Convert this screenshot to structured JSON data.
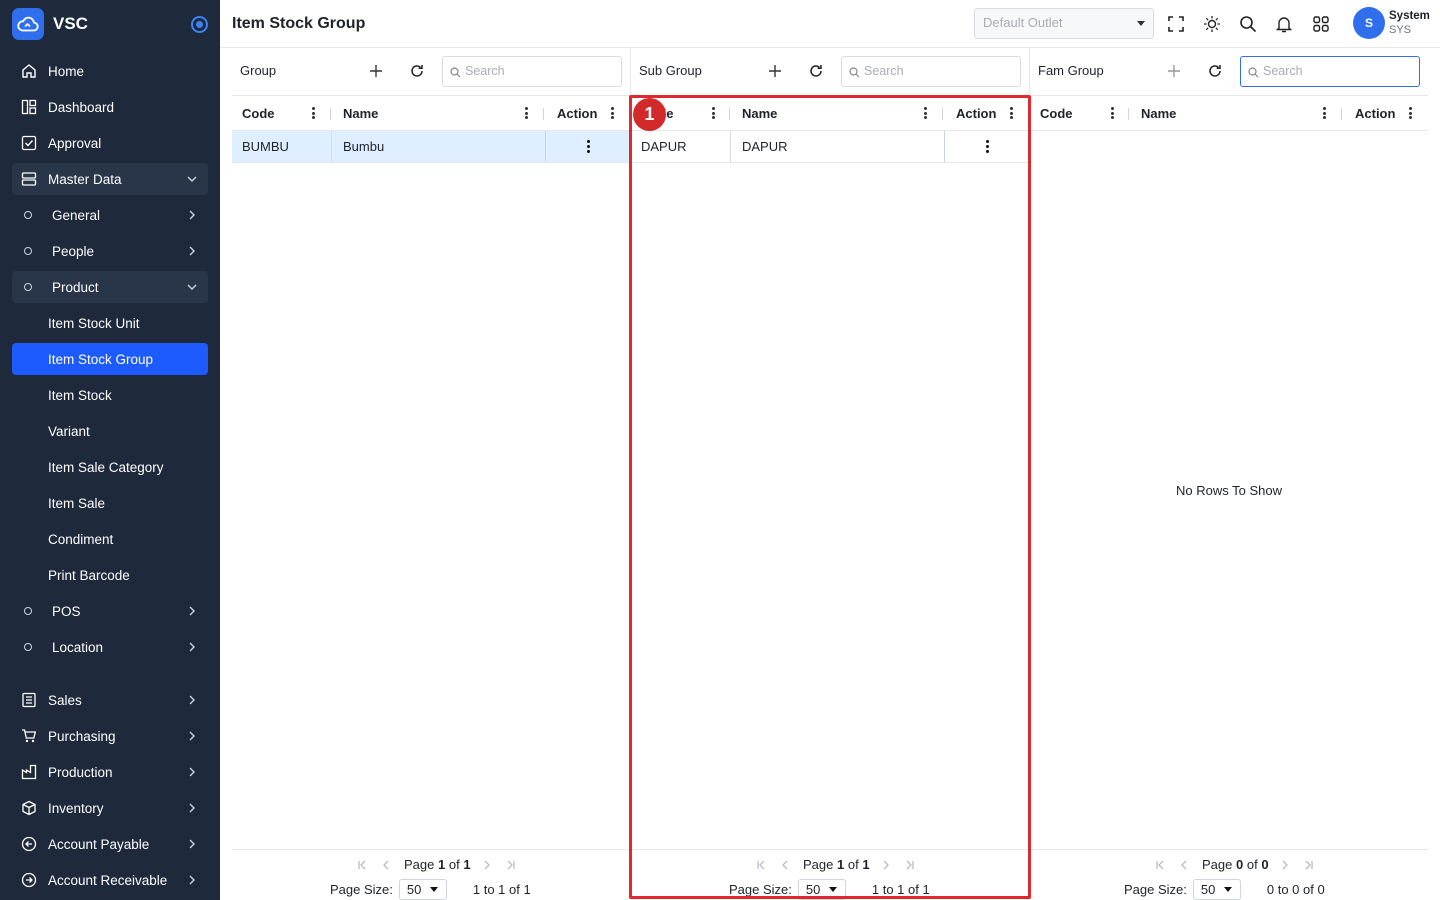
{
  "app": {
    "brand": "VSC"
  },
  "sidebar": {
    "items": [
      {
        "label": "Home",
        "icon": "home-icon"
      },
      {
        "label": "Dashboard",
        "icon": "dashboard-icon"
      },
      {
        "label": "Approval",
        "icon": "approval-icon"
      },
      {
        "label": "Master Data",
        "icon": "master-data-icon"
      }
    ],
    "master": [
      {
        "label": "General"
      },
      {
        "label": "People"
      },
      {
        "label": "Product"
      }
    ],
    "product": [
      {
        "label": "Item Stock Unit"
      },
      {
        "label": "Item Stock Group"
      },
      {
        "label": "Item Stock"
      },
      {
        "label": "Variant"
      },
      {
        "label": "Item Sale Category"
      },
      {
        "label": "Item Sale"
      },
      {
        "label": "Condiment"
      },
      {
        "label": "Print Barcode"
      }
    ],
    "master_more": [
      {
        "label": "POS"
      },
      {
        "label": "Location"
      }
    ],
    "modules": [
      {
        "label": "Sales",
        "icon": "sales-icon"
      },
      {
        "label": "Purchasing",
        "icon": "cart-icon"
      },
      {
        "label": "Production",
        "icon": "factory-icon"
      },
      {
        "label": "Inventory",
        "icon": "box-icon"
      },
      {
        "label": "Account Payable",
        "icon": "arrow-left-circle-icon"
      },
      {
        "label": "Account Receivable",
        "icon": "arrow-right-circle-icon"
      }
    ]
  },
  "header": {
    "title": "Item Stock Group",
    "outlet_placeholder": "Default Outlet",
    "user": {
      "initial": "S",
      "name": "System",
      "code": "SYS"
    }
  },
  "panels": {
    "group": {
      "title": "Group",
      "search_placeholder": "Search",
      "columns": [
        "Code",
        "Name",
        "Action"
      ],
      "rows": [
        {
          "code": "BUMBU",
          "name": "Bumbu"
        }
      ],
      "pager": {
        "page_label": "Page",
        "page": "1",
        "of": "of",
        "total": "1",
        "size_label": "Page Size:",
        "size": "50",
        "count": "1 to 1 of 1"
      }
    },
    "sub": {
      "title": "Sub Group",
      "search_placeholder": "Search",
      "columns": [
        "Code",
        "Name",
        "Action"
      ],
      "rows": [
        {
          "code": "DAPUR",
          "name": "DAPUR"
        }
      ],
      "pager": {
        "page_label": "Page",
        "page": "1",
        "of": "of",
        "total": "1",
        "size_label": "Page Size:",
        "size": "50",
        "count": "1 to 1 of 1"
      }
    },
    "fam": {
      "title": "Fam Group",
      "search_placeholder": "Search",
      "columns": [
        "Code",
        "Name",
        "Action"
      ],
      "empty": "No Rows To Show",
      "pager": {
        "page_label": "Page",
        "page": "0",
        "of": "of",
        "total": "0",
        "size_label": "Page Size:",
        "size": "50",
        "count": "0 to 0 of 0"
      }
    }
  },
  "annotation": {
    "badge": "1",
    "color": "#e0282e"
  }
}
